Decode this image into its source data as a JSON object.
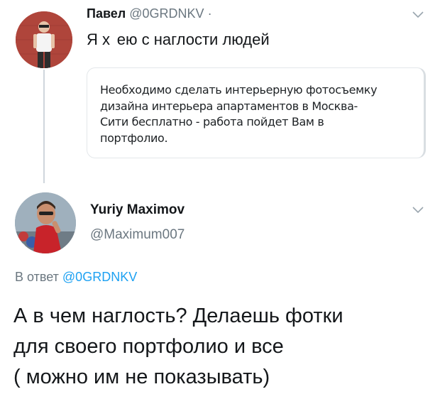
{
  "tweet1": {
    "author_name": "Павел",
    "author_handle": "@0GRDNKV",
    "separator": "·",
    "text": "Я х  ею с наглости людей",
    "quote": {
      "lines": [
        "Необходимо сделать интерьерную фотосъемку",
        "дизайна интерьера апартаментов в Москва-",
        "Сити бесплатно - работа пойдет Вам в",
        "портфолио."
      ]
    }
  },
  "tweet2": {
    "author_name": "Yuriy Maximov",
    "author_handle": "@Maximum007",
    "reply_prefix": "В ответ",
    "reply_handle": "@0GRDNKV",
    "text_lines": [
      "А в чем наглость? Делаешь фотки",
      "для своего портфолио и все",
      "( можно им не показывать)"
    ]
  },
  "icons": {
    "menu_chevron": "chevron-down-icon",
    "avatar_photo": "avatar"
  },
  "colors": {
    "text": "#14171a",
    "secondary": "#6b7780",
    "link": "#1da1f2",
    "border": "#e3e7ea"
  }
}
